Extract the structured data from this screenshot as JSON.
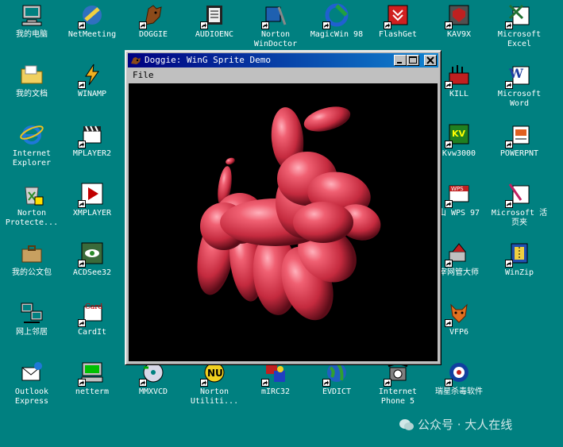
{
  "desktop": {
    "icons": [
      {
        "id": "my-computer",
        "label": "我的电脑",
        "icon": "computer-icon",
        "shortcut": false
      },
      {
        "id": "my-documents",
        "label": "我的文档",
        "icon": "folder-icon",
        "shortcut": false
      },
      {
        "id": "internet-explorer",
        "label": "Internet\nExplorer",
        "icon": "ie-icon",
        "shortcut": false
      },
      {
        "id": "norton-protecte",
        "label": "Norton\nProtecte...",
        "icon": "recycle-bin-icon",
        "shortcut": false
      },
      {
        "id": "my-briefcase",
        "label": "我的公文包",
        "icon": "briefcase-icon",
        "shortcut": false
      },
      {
        "id": "network-neighborhood",
        "label": "网上邻居",
        "icon": "network-icon",
        "shortcut": false
      },
      {
        "id": "outlook-express",
        "label": "Outlook\nExpress",
        "icon": "outlook-icon",
        "shortcut": false
      },
      {
        "id": "netmeeting",
        "label": "NetMeeting",
        "icon": "netmeeting-icon",
        "shortcut": true
      },
      {
        "id": "winamp",
        "label": "WINAMP",
        "icon": "winamp-icon",
        "shortcut": true
      },
      {
        "id": "mplayer2",
        "label": "MPLAYER2",
        "icon": "clapper-icon",
        "shortcut": true
      },
      {
        "id": "xmplayer",
        "label": "XMPLAYER",
        "icon": "play-icon",
        "shortcut": true
      },
      {
        "id": "acdsee32",
        "label": "ACDSee32",
        "icon": "acdsee-icon",
        "shortcut": true
      },
      {
        "id": "cardit",
        "label": "CardIt",
        "icon": "cardit-icon",
        "shortcut": true
      },
      {
        "id": "netterm",
        "label": "netterm",
        "icon": "terminal-icon",
        "shortcut": true
      },
      {
        "id": "doggie",
        "label": "DOGGIE",
        "icon": "doggie-icon",
        "shortcut": true
      },
      {
        "id": "audioenc",
        "label": "AUDIOENC",
        "icon": "audioenc-icon",
        "shortcut": true
      },
      {
        "id": "norton-windoctor",
        "label": "Norton\nWinDoctor",
        "icon": "windoctor-icon",
        "shortcut": true
      },
      {
        "id": "magicwin98",
        "label": "MagicWin 98",
        "icon": "magicwin-icon",
        "shortcut": true
      },
      {
        "id": "flashget",
        "label": "FlashGet",
        "icon": "flashget-icon",
        "shortcut": true
      },
      {
        "id": "kav9x",
        "label": "KAV9X",
        "icon": "kav-icon",
        "shortcut": true
      },
      {
        "id": "kill",
        "label": "KILL",
        "icon": "kill-icon",
        "shortcut": true
      },
      {
        "id": "kvw3000",
        "label": "Kvw3000",
        "icon": "kv-icon",
        "shortcut": true
      },
      {
        "id": "wps97",
        "label": "山 WPS 97",
        "icon": "wps-icon",
        "shortcut": true
      },
      {
        "id": "netadmin",
        "label": "宰网管大师",
        "icon": "netadmin-icon",
        "shortcut": true
      },
      {
        "id": "vfp6",
        "label": "VFP6",
        "icon": "fox-icon",
        "shortcut": true
      },
      {
        "id": "ms-excel",
        "label": "Microsoft\nExcel",
        "icon": "excel-icon",
        "shortcut": true
      },
      {
        "id": "ms-word",
        "label": "Microsoft\nWord",
        "icon": "word-icon",
        "shortcut": true
      },
      {
        "id": "powerpnt",
        "label": "POWERPNT",
        "icon": "powerpoint-icon",
        "shortcut": true
      },
      {
        "id": "ms-binder",
        "label": "Microsoft 活\n页夹",
        "icon": "binder-icon",
        "shortcut": true
      },
      {
        "id": "winzip",
        "label": "WinZip",
        "icon": "winzip-icon",
        "shortcut": true
      },
      {
        "id": "rising-av",
        "label": "瑞星杀毒软件",
        "icon": "rising-icon",
        "shortcut": true
      },
      {
        "id": "mmxvcd",
        "label": "MMXVCD",
        "icon": "vcd-icon",
        "shortcut": true
      },
      {
        "id": "norton-utilities",
        "label": "Norton\nUtiliti...",
        "icon": "norton-nu-icon",
        "shortcut": true
      },
      {
        "id": "mirc32",
        "label": "mIRC32",
        "icon": "mirc-icon",
        "shortcut": true
      },
      {
        "id": "evdict",
        "label": "EVDICT",
        "icon": "globe-icon",
        "shortcut": true
      },
      {
        "id": "internet-phone",
        "label": "Internet\nPhone 5",
        "icon": "phone-icon",
        "shortcut": true
      }
    ]
  },
  "window": {
    "title": "Doggie: WinG Sprite Demo",
    "menu": [
      "File"
    ],
    "scene": "balloon-dog-sprite"
  },
  "watermark": "公众号 · 大人在线",
  "colors": {
    "desktop": "#008080",
    "title_bar": "#000080",
    "balloon": "#e0475a"
  }
}
